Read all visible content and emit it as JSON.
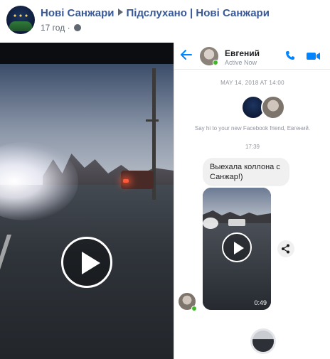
{
  "post": {
    "page_name": "Нові Санжари",
    "group_name": "Підслухано | Нові Санжари",
    "time": "17 год",
    "dot": "·"
  },
  "video": {
    "icon": "play-icon"
  },
  "messenger": {
    "contact_name": "Евгений",
    "status": "Active Now",
    "date": "MAY 14, 2018 AT 14:00",
    "intro": "Say hi to your new Facebook friend, Евгений.",
    "time": "17:39",
    "message": "Выехала коллона с Санжар!)",
    "video_duration": "0:49",
    "accent_color": "#0084ff",
    "online_color": "#42b72a"
  }
}
